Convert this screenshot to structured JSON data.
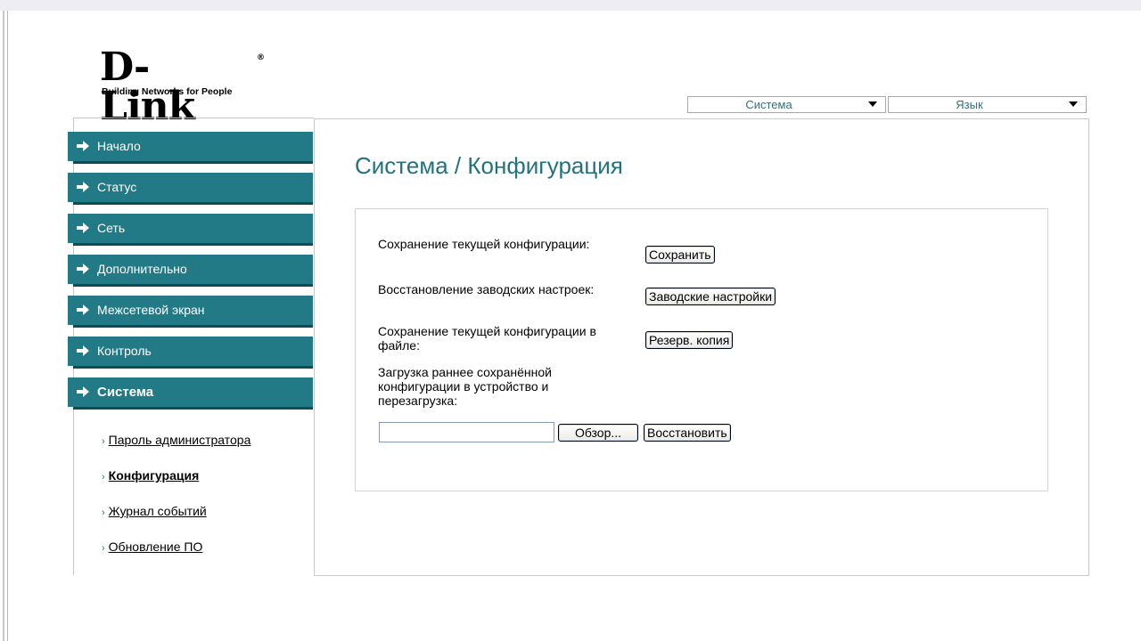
{
  "brand": {
    "logo_text": "D-Link",
    "registered_mark": "®",
    "tagline": "Building Networks for People"
  },
  "top_menus": {
    "system": {
      "label": "Система"
    },
    "language": {
      "label": "Язык"
    }
  },
  "sidebar": {
    "items": [
      {
        "label": "Начало"
      },
      {
        "label": "Статус"
      },
      {
        "label": "Сеть"
      },
      {
        "label": "Дополнительно"
      },
      {
        "label": "Межсетевой экран"
      },
      {
        "label": "Контроль"
      },
      {
        "label": "Система",
        "expanded": true
      }
    ],
    "subitems": [
      {
        "label": "Пароль администратора"
      },
      {
        "label": "Конфигурация",
        "active": true
      },
      {
        "label": "Журнал событий"
      },
      {
        "label": "Обновление ПО"
      }
    ]
  },
  "main": {
    "title": "Система / Конфигурация",
    "rows": {
      "save_label": "Сохранение текущей конфигурации:",
      "save_button": "Сохранить",
      "factory_label": "Восстановление заводских настроек:",
      "factory_button": "Заводские настройки",
      "backup_label_line1": "Сохранение текущей конфигурации в",
      "backup_label_line2": "файле:",
      "backup_button": "Резерв. копия",
      "restore_label_line1": "Загрузка раннее сохранённой",
      "restore_label_line2": "конфигурации в устройство и",
      "restore_label_line3": "перезагрузка:",
      "file_value": "",
      "browse_button": "Обзор...",
      "restore_button": "Восстановить"
    }
  },
  "colors": {
    "accent": "#217a86",
    "accent_dark": "#0f4b55",
    "title": "#23717e"
  }
}
